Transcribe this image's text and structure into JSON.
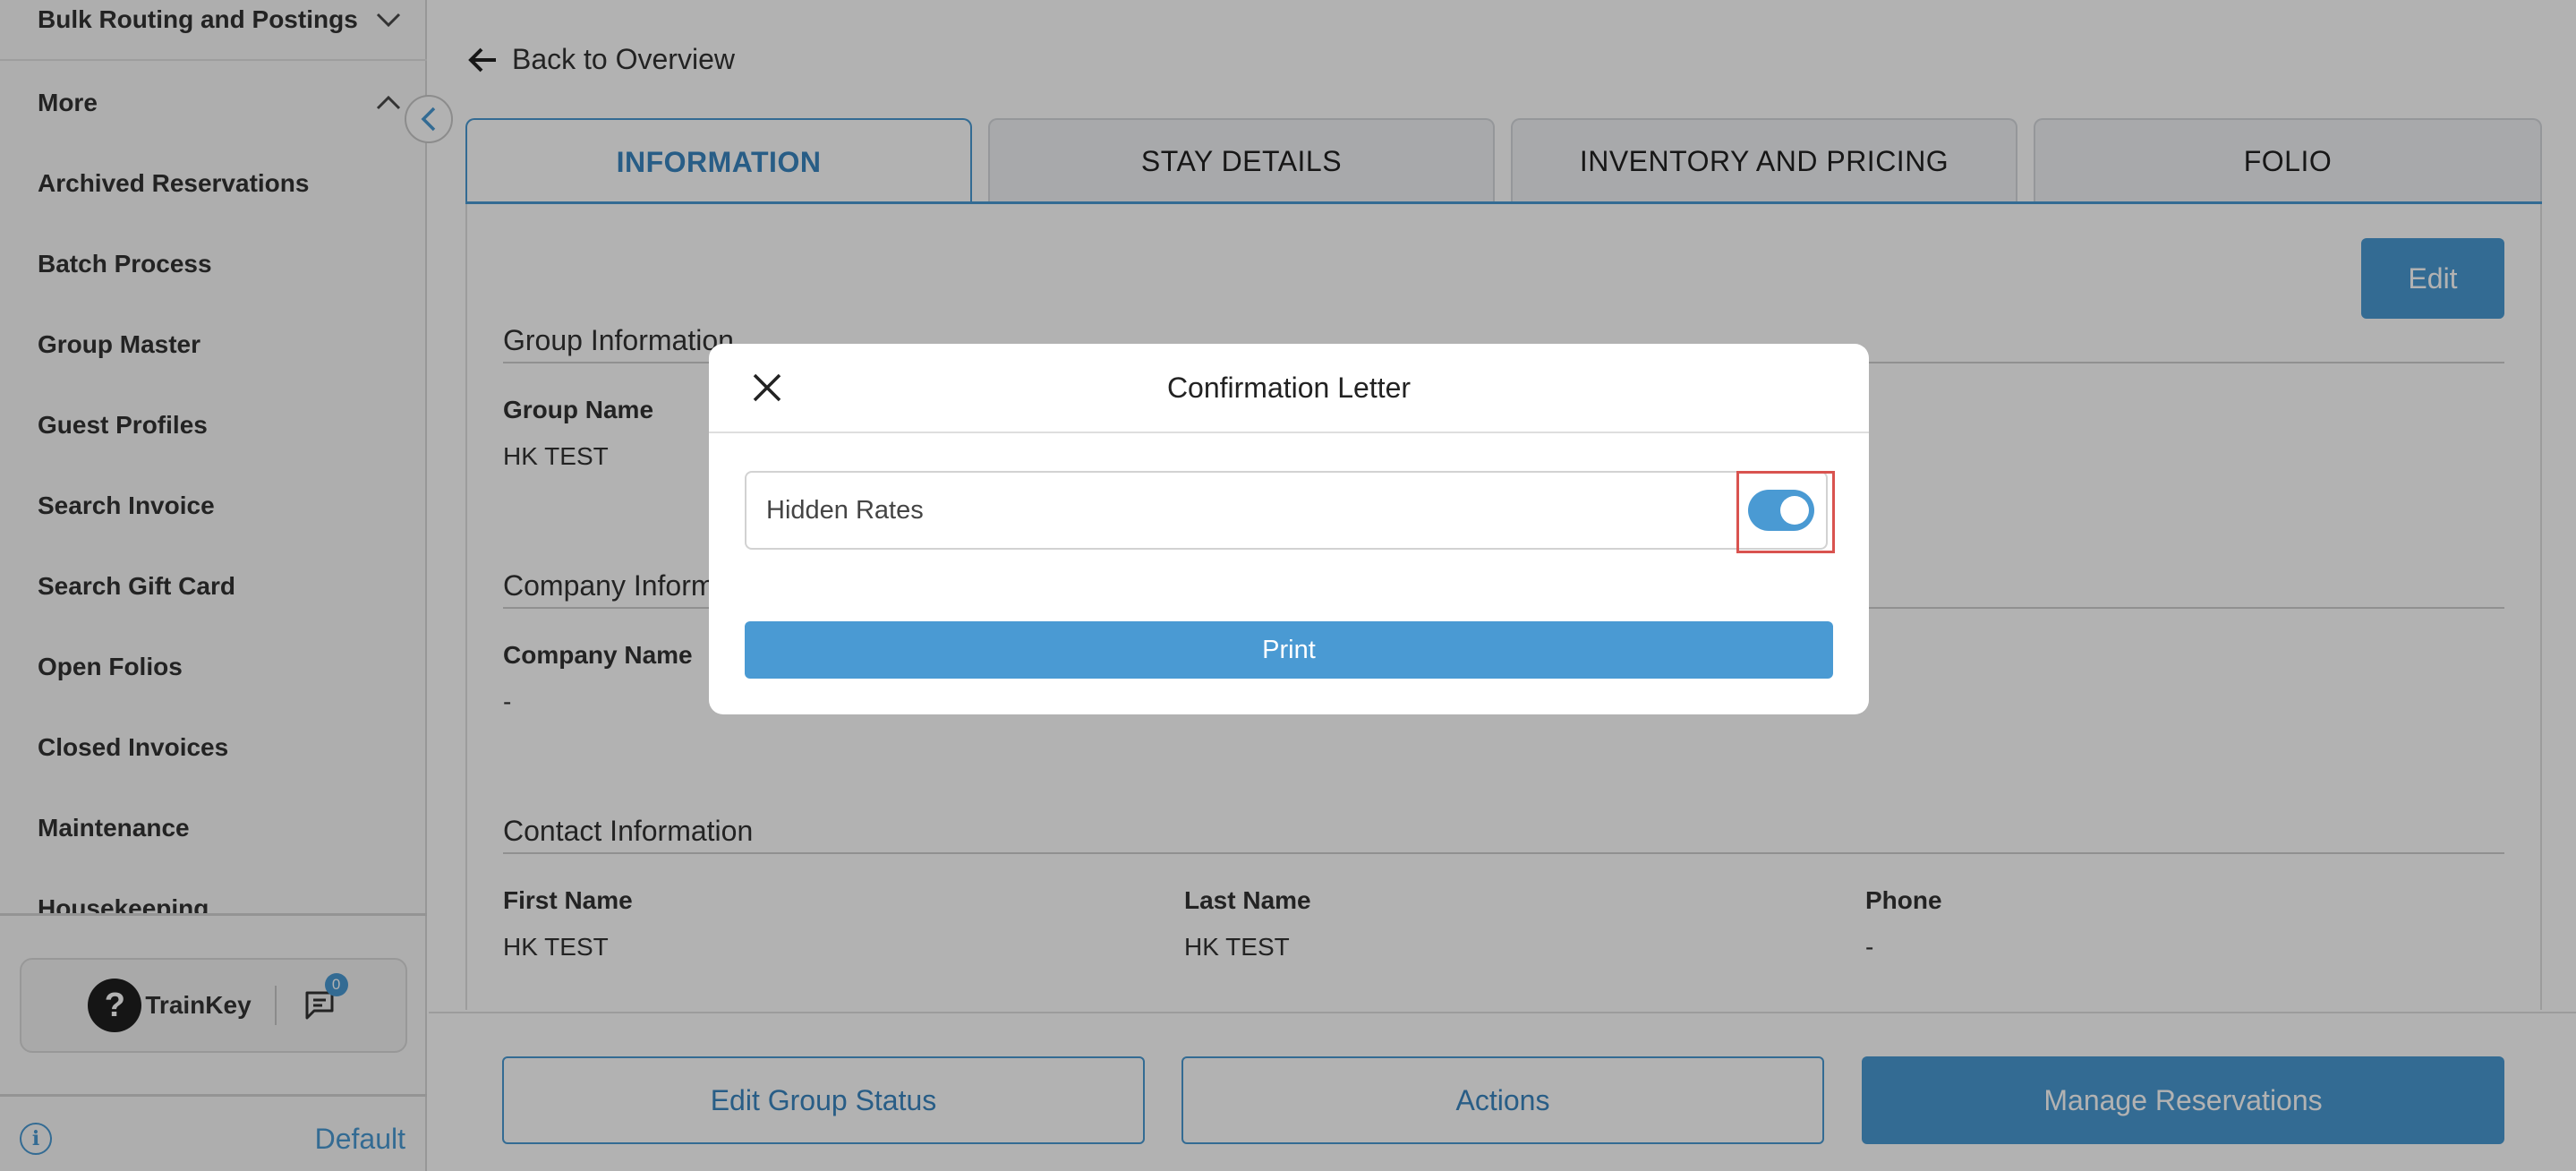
{
  "sidebar": {
    "top_group_label": "Bulk Routing and Postings",
    "more_label": "More",
    "items": [
      {
        "label": "Archived Reservations"
      },
      {
        "label": "Batch Process"
      },
      {
        "label": "Group Master"
      },
      {
        "label": "Guest Profiles"
      },
      {
        "label": "Search Invoice"
      },
      {
        "label": "Search Gift Card"
      },
      {
        "label": "Open Folios"
      },
      {
        "label": "Closed Invoices"
      },
      {
        "label": "Maintenance"
      },
      {
        "label": "Housekeeping"
      }
    ],
    "help_glyph": "?",
    "trainkey_label": "TrainKey",
    "chat_badge_count": "0",
    "info_glyph": "i",
    "footer_label": "Default"
  },
  "main": {
    "back_label": "Back to Overview",
    "tabs": [
      {
        "label": "INFORMATION",
        "active": true
      },
      {
        "label": "STAY DETAILS",
        "active": false
      },
      {
        "label": "INVENTORY AND PRICING",
        "active": false
      },
      {
        "label": "FOLIO",
        "active": false
      }
    ],
    "edit_label": "Edit",
    "group_info": {
      "title": "Group Information",
      "group_name_label": "Group Name",
      "group_name_value": "HK TEST"
    },
    "company_info": {
      "title": "Company Information",
      "company_name_label": "Company Name",
      "company_name_value": "-"
    },
    "contact_info": {
      "title": "Contact Information",
      "first_name_label": "First Name",
      "first_name_value": "HK TEST",
      "last_name_label": "Last Name",
      "last_name_value": "HK TEST",
      "phone_label": "Phone",
      "phone_value": "-"
    },
    "buttons": {
      "edit_group_status": "Edit Group Status",
      "actions": "Actions",
      "manage_reservations": "Manage Reservations"
    }
  },
  "modal": {
    "title": "Confirmation Letter",
    "toggle_label": "Hidden Rates",
    "toggle_on": true,
    "print_label": "Print"
  },
  "colors": {
    "accent": "#4a9ad3",
    "highlight": "#d9534f"
  },
  "icons": {
    "back": "arrow-left-icon",
    "close": "close-icon",
    "collapse": "chevron-left-icon",
    "chat": "chat-icon",
    "info": "info-icon"
  }
}
